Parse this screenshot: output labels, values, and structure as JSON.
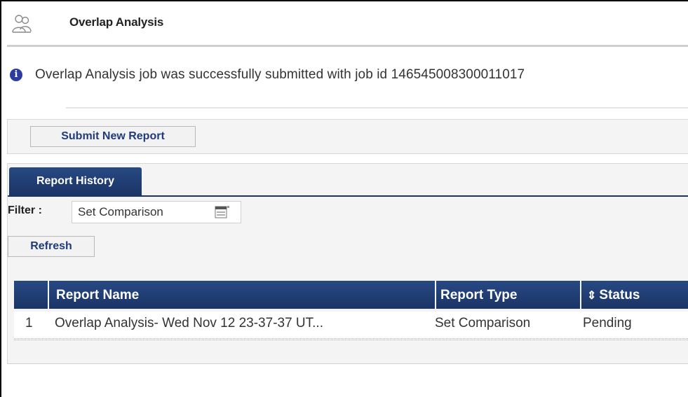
{
  "header": {
    "icon": "people-icon",
    "title": "Overlap Analysis"
  },
  "message": {
    "icon": "info-icon",
    "icon_glyph": "i",
    "text": "Overlap Analysis job was successfully submitted with job id 146545008300011017"
  },
  "actions": {
    "submit_label": "Submit New Report"
  },
  "history": {
    "tab_label": "Report History",
    "filter_label": "Filter :",
    "filter_value": "Set Comparison",
    "filter_icon": "dropdown-list-icon",
    "refresh_label": "Refresh",
    "columns": [
      "",
      "Report Name",
      "Report Type",
      "Status"
    ],
    "sort_icon": "sort-icon",
    "sort_glyph": "⇕",
    "rows": [
      {
        "index": "1",
        "name": "Overlap Analysis- Wed Nov 12 23-37-37 UT...",
        "type": "Set Comparison",
        "status": "Pending"
      }
    ]
  },
  "colors": {
    "header_blue": "#1a3466",
    "button_text": "#1f3b7a",
    "info_icon": "#2a3d9c"
  }
}
